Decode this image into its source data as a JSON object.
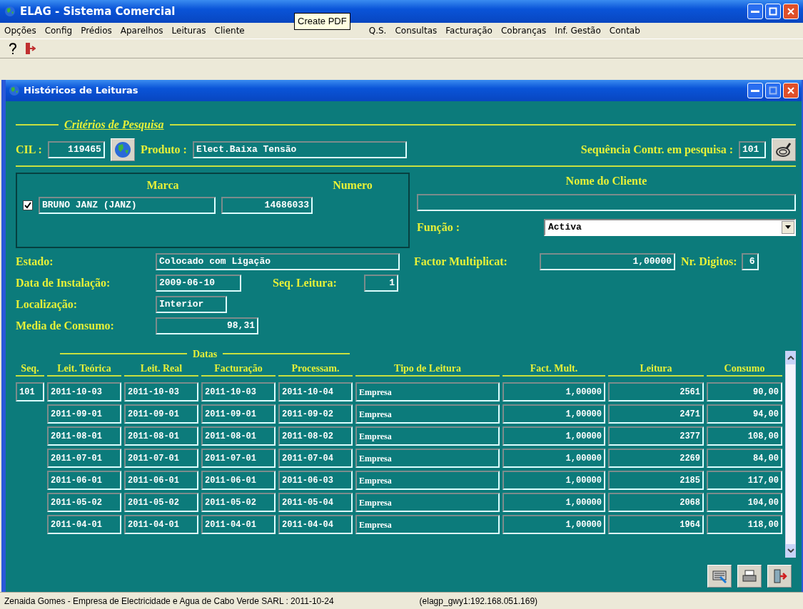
{
  "app": {
    "title": "ELAG - Sistema Comercial"
  },
  "menu": [
    {
      "label": "Opções"
    },
    {
      "label": "Config"
    },
    {
      "label": "Prédios"
    },
    {
      "label": "Aparelhos"
    },
    {
      "label": "Leituras"
    },
    {
      "label": "Cliente"
    },
    {
      "label": "Q.S."
    },
    {
      "label": "Consultas"
    },
    {
      "label": "Facturação"
    },
    {
      "label": "Cobranças"
    },
    {
      "label": "Inf. Gestão"
    },
    {
      "label": "Contab"
    }
  ],
  "tooltip": "Create PDF",
  "window": {
    "title": "Históricos de Leituras"
  },
  "search": {
    "legend": "Critérios de Pesquisa",
    "cil_label": "CIL :",
    "cil": "119465",
    "produto_label": "Produto :",
    "produto": "Elect.Baixa Tensão",
    "seq_label": "Sequência Contr. em pesquisa :",
    "seq": "101"
  },
  "meter": {
    "marca_heading": "Marca",
    "numero_heading": "Numero",
    "checked": true,
    "marca": "BRUNO JANZ (JANZ)",
    "numero": "14686033"
  },
  "client": {
    "heading": "Nome do Cliente",
    "funcao_label": "Função :",
    "funcao": "Activa",
    "factor_label": "Factor Multiplicat:",
    "factor": "1,00000",
    "digits_label": "Nr. Digitos:",
    "digits": "6"
  },
  "details": {
    "estado_label": "Estado:",
    "estado": "Colocado com Ligação",
    "data_label": "Data de Instalação:",
    "data": "2009-06-10",
    "seq_label": "Seq. Leitura:",
    "seq": "1",
    "local_label": "Localização:",
    "local": "Interior",
    "media_label": "Media de Consumo:",
    "media": "98,31"
  },
  "table": {
    "group_heading": "Datas",
    "columns": [
      "Seq.",
      "Leit. Teórica",
      "Leit. Real",
      "Facturação",
      "Processam.",
      "Tipo de Leitura",
      "Fact. Mult.",
      "Leitura",
      "Consumo"
    ],
    "rows": [
      {
        "cells": [
          "101",
          "2011-10-03",
          "2011-10-03",
          "2011-10-03",
          "2011-10-04",
          "Empresa",
          "1,00000",
          "2561",
          "90,00"
        ]
      },
      {
        "cells": [
          "",
          "2011-09-01",
          "2011-09-01",
          "2011-09-01",
          "2011-09-02",
          "Empresa",
          "1,00000",
          "2471",
          "94,00"
        ]
      },
      {
        "cells": [
          "",
          "2011-08-01",
          "2011-08-01",
          "2011-08-01",
          "2011-08-02",
          "Empresa",
          "1,00000",
          "2377",
          "108,00"
        ]
      },
      {
        "cells": [
          "",
          "2011-07-01",
          "2011-07-01",
          "2011-07-01",
          "2011-07-04",
          "Empresa",
          "1,00000",
          "2269",
          "84,00"
        ]
      },
      {
        "cells": [
          "",
          "2011-06-01",
          "2011-06-01",
          "2011-06-01",
          "2011-06-03",
          "Empresa",
          "1,00000",
          "2185",
          "117,00"
        ]
      },
      {
        "cells": [
          "",
          "2011-05-02",
          "2011-05-02",
          "2011-05-02",
          "2011-05-04",
          "Empresa",
          "1,00000",
          "2068",
          "104,00"
        ]
      },
      {
        "cells": [
          "",
          "2011-04-01",
          "2011-04-01",
          "2011-04-01",
          "2011-04-04",
          "Empresa",
          "1,00000",
          "1964",
          "118,00"
        ]
      }
    ]
  },
  "status_bar": [
    "Zenaida Gomes - Empresa de Electricidade e Agua de Cabo Verde SARL : 2011-10-24",
    "(elagp_gwy1:192.168.051.169)"
  ]
}
